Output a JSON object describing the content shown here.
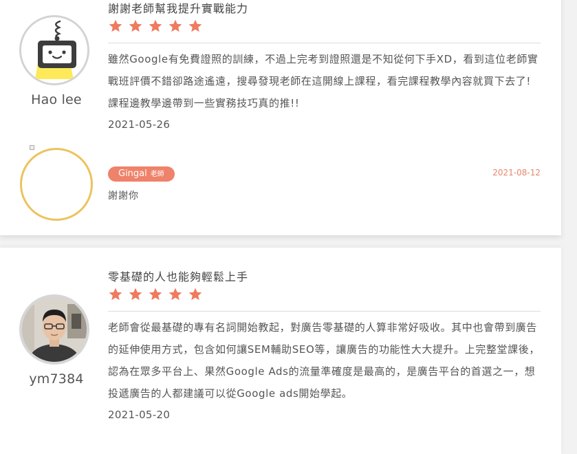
{
  "reviews": [
    {
      "user": "Hao lee",
      "avatar": "robot-avatar",
      "title": "謝謝老師幫我提升實戰能力",
      "rating": 5,
      "body": "雖然Google有免費證照的訓練，不過上完考到證照還是不知從何下手XD，看到這位老師實戰班評價不錯卻路途遙遠，搜尋發現老師在這開線上課程，看完課程教學內容就買下去了!課程邊教學邊帶到一些實務技巧真的推!!",
      "date": "2021-05-26",
      "reply": {
        "teacher": "Gingal",
        "role": "老師",
        "date": "2021-08-12",
        "text": "謝謝你"
      }
    },
    {
      "user": "ym7384",
      "avatar": "user-photo-avatar",
      "title": "零基礎的人也能夠輕鬆上手",
      "rating": 5,
      "body": "老師會從最基礎的專有名詞開始教起，對廣告零基礎的人算非常好吸收。其中也會帶到廣告的延伸使用方式，包含如何讓SEM輔助SEO等，讓廣告的功能性大大提升。上完整堂課後，認為在眾多平台上、果然Google Ads的流量準確度是最高的，是廣告平台的首選之一，想投遞廣告的人都建議可以從Google ads開始學起。",
      "date": "2021-05-20"
    }
  ],
  "colors": {
    "star": "#ef7a5e",
    "badge": "#ef826a",
    "reply_date": "#e5866b",
    "reply_avatar_ring": "#ecc35c"
  }
}
